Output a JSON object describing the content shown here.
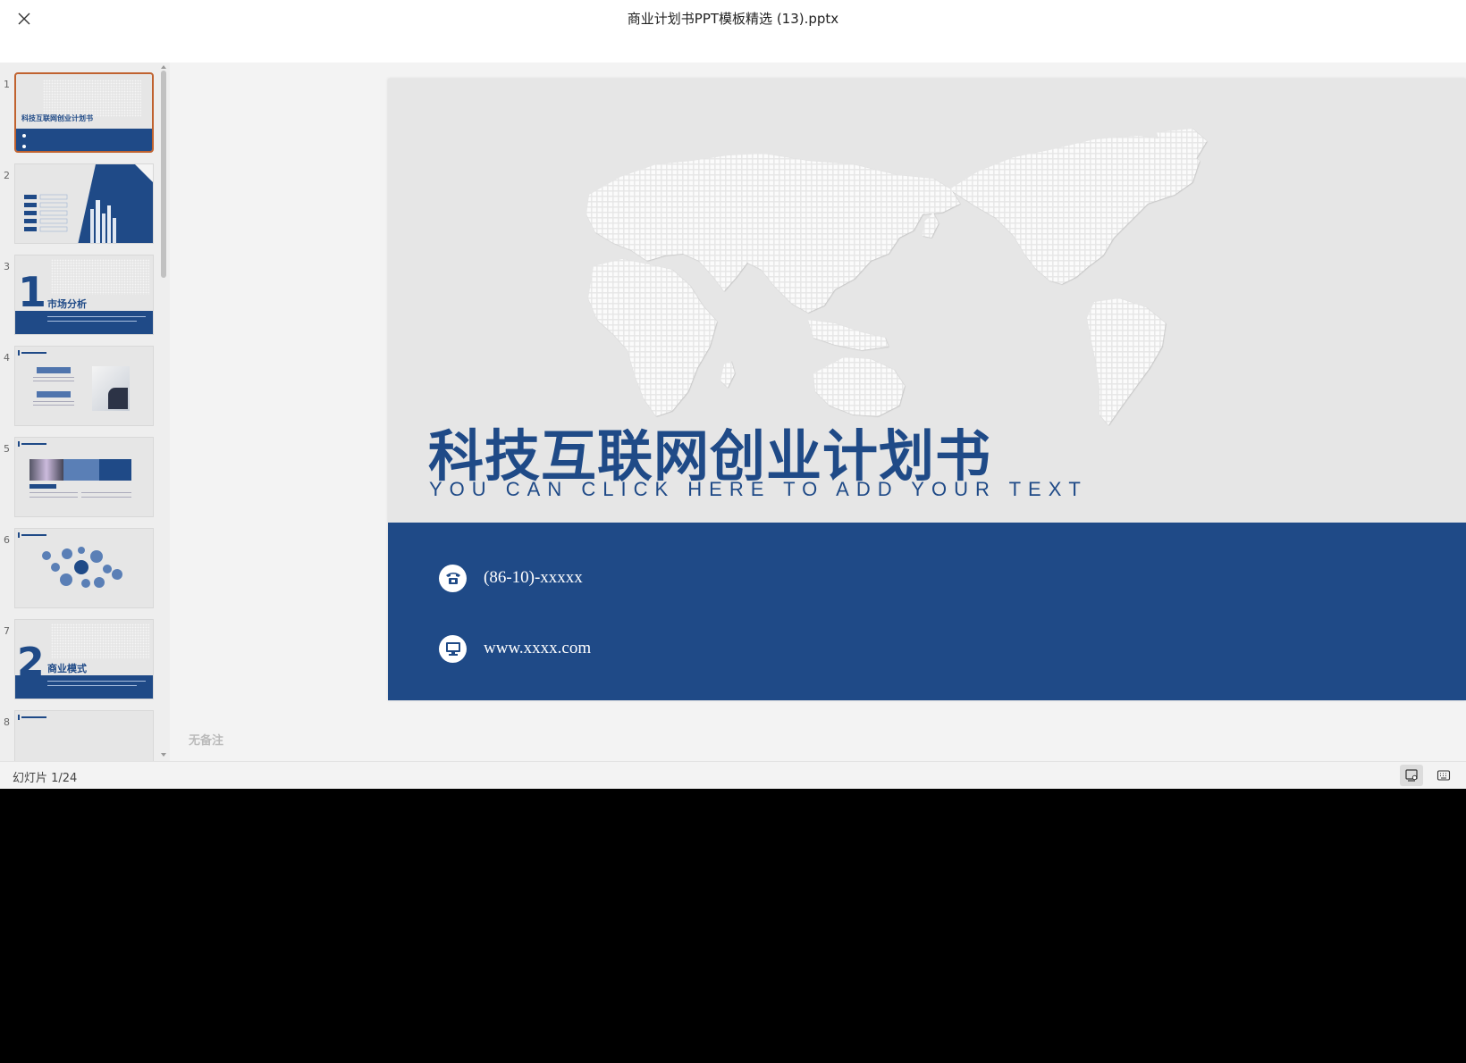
{
  "header": {
    "title": "商业计划书PPT模板精选 (13).pptx"
  },
  "sidebar": {
    "thumbnails": [
      {
        "num": "1",
        "title": "科技互联网创业计划书"
      },
      {
        "num": "2"
      },
      {
        "num": "3",
        "title": "市场分析",
        "big_num": "1"
      },
      {
        "num": "4"
      },
      {
        "num": "5"
      },
      {
        "num": "6"
      },
      {
        "num": "7",
        "title": "商业模式",
        "big_num": "2"
      },
      {
        "num": "8"
      }
    ]
  },
  "slide": {
    "title": "科技互联网创业计划书",
    "subtitle": "YOU CAN CLICK HERE TO ADD YOUR TEXT",
    "phone": "(86-10)-xxxxx",
    "website": "www.xxxx.com"
  },
  "notes": {
    "text": "无备注"
  },
  "statusbar": {
    "counter": "幻灯片 1/24"
  },
  "colors": {
    "brand_blue": "#1f4a87",
    "active_border": "#c0622f"
  }
}
